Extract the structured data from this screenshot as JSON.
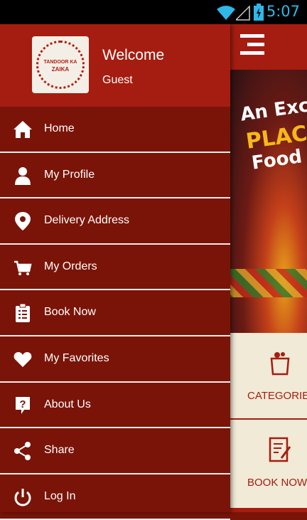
{
  "status_bar": {
    "time": "5:07"
  },
  "drawer": {
    "logo": {
      "line1": "TANDOOR KA",
      "line2": "ZAIKA"
    },
    "welcome": "Welcome",
    "user": "Guest",
    "items": [
      {
        "label": "Home",
        "icon": "home-icon"
      },
      {
        "label": "My Profile",
        "icon": "person-icon"
      },
      {
        "label": "Delivery Address",
        "icon": "location-pin-icon"
      },
      {
        "label": "My Orders",
        "icon": "cart-icon"
      },
      {
        "label": "Book Now",
        "icon": "clipboard-icon"
      },
      {
        "label": "My Favorites",
        "icon": "heart-icon"
      },
      {
        "label": "About Us",
        "icon": "question-icon"
      },
      {
        "label": "Share",
        "icon": "share-icon"
      },
      {
        "label": "Log In",
        "icon": "power-icon"
      }
    ]
  },
  "behind": {
    "banner": {
      "line1": "An Exc",
      "line2": "PLAC",
      "line3": "Food"
    },
    "tiles": [
      {
        "label": "CATEGORIE",
        "icon": "grocery-bag-icon"
      },
      {
        "label": "BOOK NOW",
        "icon": "edit-form-icon"
      }
    ]
  },
  "colors": {
    "drawer_bg": "#7a1408",
    "header_bg": "#a51d10",
    "content_bg": "#f1ead7",
    "clock": "#2fb7e8"
  }
}
